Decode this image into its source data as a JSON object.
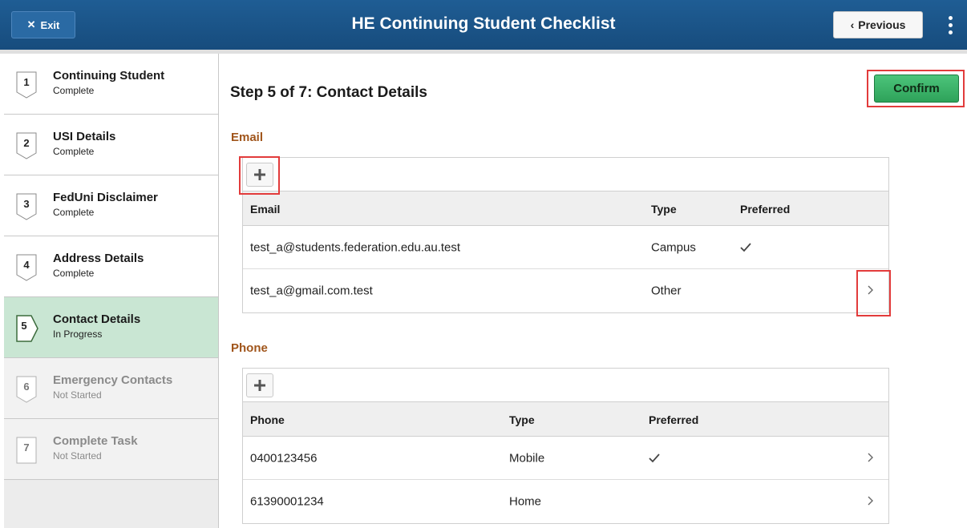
{
  "header": {
    "exit_icon": "close-icon",
    "exit_label": "Exit",
    "title": "HE Continuing Student Checklist",
    "previous_icon": "chevron-left-icon",
    "previous_label": "Previous",
    "menu_icon": "kebab-menu-icon"
  },
  "sidebar": {
    "steps": [
      {
        "number": "1",
        "name": "Continuing Student",
        "status": "Complete"
      },
      {
        "number": "2",
        "name": "USI Details",
        "status": "Complete"
      },
      {
        "number": "3",
        "name": "FedUni Disclaimer",
        "status": "Complete"
      },
      {
        "number": "4",
        "name": "Address Details",
        "status": "Complete"
      },
      {
        "number": "5",
        "name": "Contact Details",
        "status": "In Progress"
      },
      {
        "number": "6",
        "name": "Emergency Contacts",
        "status": "Not Started"
      },
      {
        "number": "7",
        "name": "Complete Task",
        "status": "Not Started"
      }
    ]
  },
  "main": {
    "title": "Step 5 of 7: Contact Details",
    "confirm_label": "Confirm"
  },
  "email": {
    "section_label": "Email",
    "columns": {
      "email": "Email",
      "type": "Type",
      "preferred": "Preferred"
    },
    "rows": [
      {
        "email": "test_a@students.federation.edu.au.test",
        "type": "Campus",
        "preferred": true
      },
      {
        "email": "test_a@gmail.com.test",
        "type": "Other",
        "preferred": false
      }
    ]
  },
  "phone": {
    "section_label": "Phone",
    "columns": {
      "phone": "Phone",
      "type": "Type",
      "preferred": "Preferred"
    },
    "rows": [
      {
        "phone": "0400123456",
        "type": "Mobile",
        "preferred": true
      },
      {
        "phone": "61390001234",
        "type": "Home",
        "preferred": false
      }
    ]
  },
  "colors": {
    "header": "#1f5d94",
    "confirm": "#3bb36a",
    "active_step": "#c9e6d3",
    "section_label": "#a0551b",
    "highlight_outline": "#e23b3b"
  }
}
